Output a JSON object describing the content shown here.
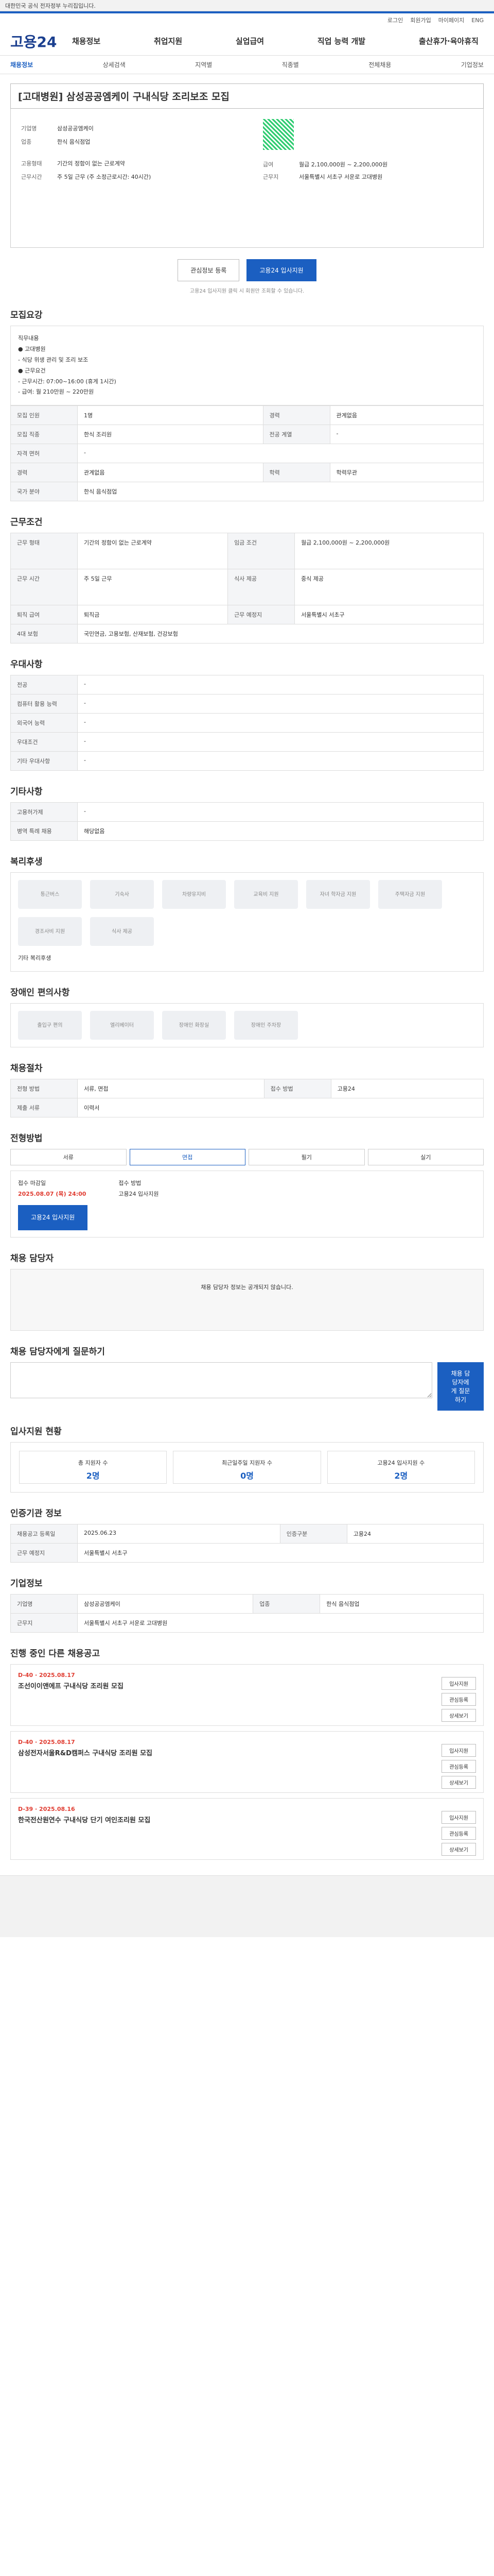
{
  "topbar": {
    "notice": "대한민국 공식 전자정부 누리집입니다.",
    "links": [
      "로그인",
      "회원가입"
    ]
  },
  "util": [
    "로그인",
    "회원가입",
    "마이페이지",
    "ENG"
  ],
  "logo": "고용24",
  "gnb": [
    "채용정보",
    "취업지원",
    "실업급여",
    "직업 능력 개발",
    "출산휴가·육아휴직"
  ],
  "subnav": [
    "채용정보",
    "상세검색",
    "지역별",
    "직종별",
    "전체채용",
    "기업정보"
  ],
  "job": {
    "title": "[고대병원] 삼성공공엠케이 구내식당 조리보조 모집",
    "company_label": "기업명",
    "company": "삼성공공엠케이",
    "kind_label": "업종",
    "kind": "한식 음식점업",
    "wage_label": "급여",
    "wage": "월급 2,100,000원 ~ 2,200,000원",
    "place_label": "근무지",
    "place": "서울특별시 서초구 서운로 고대병원",
    "emp_label": "고용형태",
    "emp": "기간의 정함이 없는 근로계약",
    "hours_label": "근무시간",
    "hours": "주 5일 근무 (주 소정근로시간: 40시간)"
  },
  "buttons": {
    "scrap": "관심정보 등록",
    "apply": "고용24 입사지원"
  },
  "note": "고용24 입사지원 클릭 시 회원만 조회할 수 있습니다.",
  "sec_recruit": "모집요강",
  "recruit_box": [
    "직무내용",
    "● 고대병원",
    "- 식당 위생 관리 및 조리 보조",
    "● 근무요건",
    "- 근무시간: 07:00~16:00 (휴게 1시간)",
    "- 급여: 월 210만원 ~ 220만원"
  ],
  "recruit_rows": [
    [
      "모집 인원",
      "1명",
      "경력",
      "관계없음"
    ],
    [
      "모집 직종",
      "한식 조리원",
      "전공 계열",
      "-"
    ],
    [
      "자격 면허",
      "-",
      "",
      ""
    ],
    [
      "경력",
      "관계없음",
      "학력",
      "학력무관"
    ],
    [
      "국가 분야",
      "한식 음식점업",
      "",
      ""
    ]
  ],
  "sec_condition": "근무조건",
  "cond_rows": [
    [
      "근무 형태",
      "기간의 정함이 없는 근로계약",
      "임금 조건",
      "월급 2,100,000원 ~ 2,200,000원"
    ],
    [
      "근무 시간",
      "주 5일 근무",
      "식사 제공",
      "중식 제공"
    ],
    [
      "퇴직 급여",
      "퇴직금",
      "근무 예정지",
      "서울특별시 서초구"
    ],
    [
      "4대 보험",
      "국민연금, 고용보험, 산재보험, 건강보험",
      "",
      ""
    ]
  ],
  "sec_prefer": "우대사항",
  "prefer_rows": [
    [
      "전공",
      "-"
    ],
    [
      "컴퓨터 활용 능력",
      "-"
    ],
    [
      "외국어 능력",
      "-"
    ],
    [
      "우대조건",
      "-"
    ],
    [
      "기타 우대사항",
      "-"
    ]
  ],
  "sec_etc": "기타사항",
  "etc_rows": [
    [
      "고용허가제",
      "-"
    ],
    [
      "병역 특례 채용",
      "해당없음"
    ]
  ],
  "sec_welfare": "복리후생",
  "welfare_icons": [
    "통근버스",
    "기숙사",
    "차량유지비",
    "교육비 지원",
    "자녀 학자금 지원",
    "주택자금 지원",
    "경조사비 지원",
    "식사 제공"
  ],
  "welfare_note": "기타 복리후생",
  "sec_disabled": "장애인 편의사항",
  "disabled_icons": [
    "출입구 편의",
    "엘리베이터",
    "장애인 화장실",
    "장애인 주차장"
  ],
  "sec_process": "채용절차",
  "process_rows": [
    [
      "전형 방법",
      "서류, 면접",
      "접수 방법",
      "고용24"
    ],
    [
      "제출 서류",
      "이력서",
      "",
      ""
    ]
  ],
  "sec_apply": "전형방법",
  "apply_tabs": [
    "서류",
    "면접",
    "필기",
    "실기"
  ],
  "apply_info": {
    "deadline_label": "접수 마감일",
    "deadline": "2025.08.07 (목) 24:00",
    "contact_label": "접수 방법",
    "contact": "고용24 입사지원"
  },
  "sec_contact": "채용 담당자",
  "contact_text": "채용 담당자 정보는 공개되지 않습니다.",
  "sec_inquiry": "채용 담당자에게 질문하기",
  "sec_stats": "입사지원 현황",
  "stats": [
    {
      "label": "총 지원자 수",
      "val": "2명"
    },
    {
      "label": "최근일주일 지원자 수",
      "val": "0명"
    },
    {
      "label": "고용24 입사지원 수",
      "val": "2명"
    }
  ],
  "sec_info": "인증기관 정보",
  "info_rows": [
    [
      "채용공고 등록일",
      "2025.06.23",
      "인증구분",
      "고용24"
    ],
    [
      "근무 예정지",
      "서울특별시 서초구",
      "",
      ""
    ]
  ],
  "sec_company": "기업정보",
  "sec_similar": "진행 중인 다른 채용공고",
  "similar": [
    {
      "tag": "D-40 · 2025.08.17",
      "name": "조선이이앤에프 구내식당 조리원 모집",
      "b1": "입사지원",
      "b2": "관심등록",
      "b3": "상세보기"
    },
    {
      "tag": "D-40 · 2025.08.17",
      "name": "삼성전자서울R&D캠퍼스 구내식당 조리원 모집",
      "b1": "입사지원",
      "b2": "관심등록",
      "b3": "상세보기"
    },
    {
      "tag": "D-39 · 2025.08.16",
      "name": "한국전산원연수 구내식당 단기 여인조리원 모집",
      "b1": "입사지원",
      "b2": "관심등록",
      "b3": "상세보기"
    }
  ]
}
